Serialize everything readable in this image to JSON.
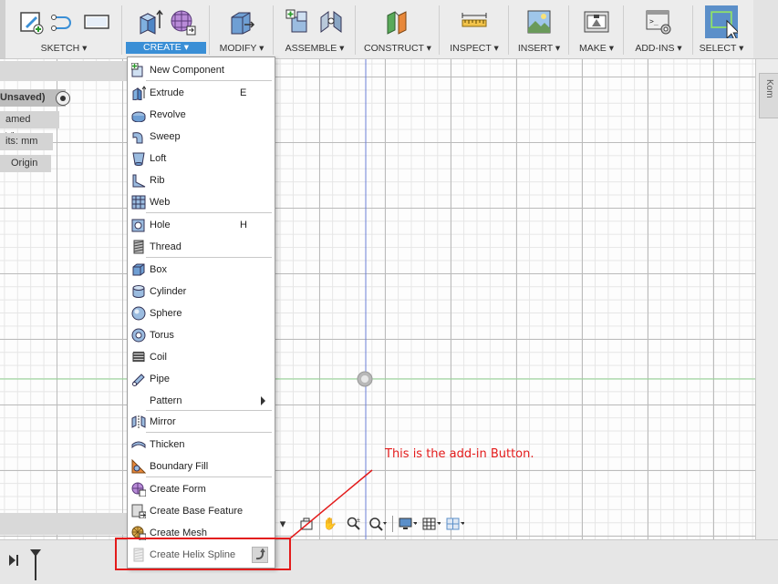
{
  "toolbar": {
    "groups": [
      {
        "label": "SKETCH ▾",
        "active": false
      },
      {
        "label": "CREATE ▾",
        "active": true
      },
      {
        "label": "MODIFY ▾",
        "active": false
      },
      {
        "label": "ASSEMBLE ▾",
        "active": false
      },
      {
        "label": "CONSTRUCT ▾",
        "active": false
      },
      {
        "label": "INSPECT ▾",
        "active": false
      },
      {
        "label": "INSERT ▾",
        "active": false
      },
      {
        "label": "MAKE ▾",
        "active": false
      },
      {
        "label": "ADD-INS ▾",
        "active": false
      },
      {
        "label": "SELECT ▾",
        "active": false
      }
    ]
  },
  "browser": {
    "document": "Unsaved)",
    "named_views": "amed Views",
    "units": "its: mm",
    "origin": "Origin"
  },
  "right_tab": "Kom",
  "create_menu": {
    "items": [
      {
        "label": "New Component",
        "shortcut": "",
        "icon": "new-component-icon"
      },
      {
        "label": "Extrude",
        "shortcut": "E",
        "icon": "extrude-icon"
      },
      {
        "label": "Revolve",
        "shortcut": "",
        "icon": "revolve-icon"
      },
      {
        "label": "Sweep",
        "shortcut": "",
        "icon": "sweep-icon"
      },
      {
        "label": "Loft",
        "shortcut": "",
        "icon": "loft-icon"
      },
      {
        "label": "Rib",
        "shortcut": "",
        "icon": "rib-icon"
      },
      {
        "label": "Web",
        "shortcut": "",
        "icon": "web-icon"
      },
      {
        "label": "Hole",
        "shortcut": "H",
        "icon": "hole-icon"
      },
      {
        "label": "Thread",
        "shortcut": "",
        "icon": "thread-icon"
      },
      {
        "label": "Box",
        "shortcut": "",
        "icon": "box-icon"
      },
      {
        "label": "Cylinder",
        "shortcut": "",
        "icon": "cylinder-icon"
      },
      {
        "label": "Sphere",
        "shortcut": "",
        "icon": "sphere-icon"
      },
      {
        "label": "Torus",
        "shortcut": "",
        "icon": "torus-icon"
      },
      {
        "label": "Coil",
        "shortcut": "",
        "icon": "coil-icon"
      },
      {
        "label": "Pipe",
        "shortcut": "",
        "icon": "pipe-icon"
      },
      {
        "label": "Pattern",
        "shortcut": "",
        "icon": "pattern-icon"
      },
      {
        "label": "Mirror",
        "shortcut": "",
        "icon": "mirror-icon"
      },
      {
        "label": "Thicken",
        "shortcut": "",
        "icon": "thicken-icon"
      },
      {
        "label": "Boundary Fill",
        "shortcut": "",
        "icon": "boundary-fill-icon"
      },
      {
        "label": "Create Form",
        "shortcut": "",
        "icon": "create-form-icon"
      },
      {
        "label": "Create Base Feature",
        "shortcut": "",
        "icon": "base-feature-icon"
      },
      {
        "label": "Create Mesh",
        "shortcut": "",
        "icon": "create-mesh-icon"
      },
      {
        "label": "Create Helix Spline",
        "shortcut": "",
        "icon": "helix-spline-icon"
      }
    ]
  },
  "annotation": "This is the add-in Button.",
  "colors": {
    "accent": "#3a8fd6",
    "annotation": "#e31b1b",
    "selection": "#5b8fc9"
  }
}
